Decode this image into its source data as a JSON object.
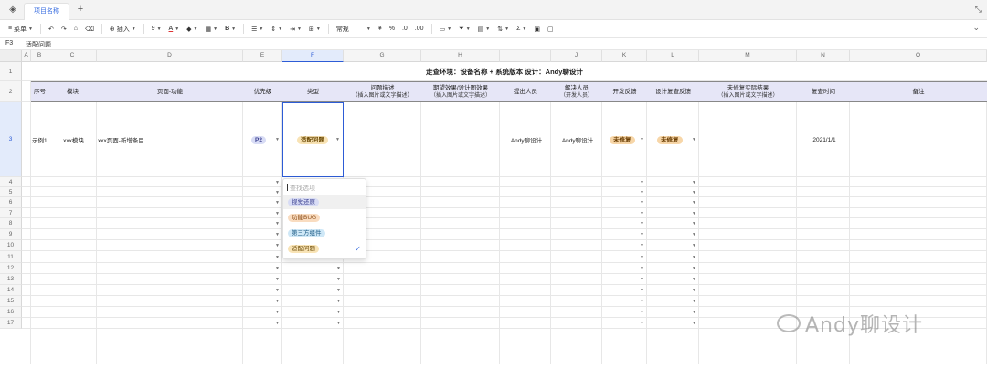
{
  "tabbar": {
    "tab_label": "项目名称",
    "add_label": "+",
    "resize_label": "⤡"
  },
  "toolbar": {
    "menu_label": "菜单",
    "insert_label": "插入",
    "font_size": "9",
    "format_label": "常规",
    "currency_symbol": "¥",
    "percent_symbol": "%",
    "sum_symbol": "Σ"
  },
  "formula": {
    "cell_ref": "F3",
    "value": "适配问题"
  },
  "columns": [
    "A",
    "B",
    "C",
    "D",
    "E",
    "F",
    "G",
    "H",
    "I",
    "J",
    "K",
    "L",
    "M",
    "N",
    "O"
  ],
  "rows": [
    "1",
    "2",
    "3",
    "4",
    "5",
    "6",
    "7",
    "8",
    "9",
    "10",
    "11",
    "12",
    "13",
    "14",
    "15",
    "16",
    "17"
  ],
  "sheet": {
    "title": "走查环境：设备名称 + 系统版本   设计：Andy聊设计",
    "headers": [
      {
        "col": "B",
        "main": "序号",
        "sub": ""
      },
      {
        "col": "C",
        "main": "模块",
        "sub": ""
      },
      {
        "col": "D",
        "main": "页面-功能",
        "sub": ""
      },
      {
        "col": "E",
        "main": "优先级",
        "sub": ""
      },
      {
        "col": "F",
        "main": "类型",
        "sub": ""
      },
      {
        "col": "G",
        "main": "问题描述",
        "sub": "（插入图片或文字描述）"
      },
      {
        "col": "H",
        "main": "期望效果/设计图效果",
        "sub": "（插入图片或文字描述）"
      },
      {
        "col": "I",
        "main": "提出人员",
        "sub": ""
      },
      {
        "col": "J",
        "main": "解决人员",
        "sub": "（开发人员）"
      },
      {
        "col": "K",
        "main": "开发反馈",
        "sub": ""
      },
      {
        "col": "L",
        "main": "设计复查反馈",
        "sub": ""
      },
      {
        "col": "M",
        "main": "未修复实际结果",
        "sub": "（插入图片或文字描述）"
      },
      {
        "col": "N",
        "main": "复查时间",
        "sub": ""
      },
      {
        "col": "O",
        "main": "备注",
        "sub": ""
      }
    ],
    "row3": {
      "index": "示例1",
      "module": "xxx模块",
      "page": "xxx页面-新增条目",
      "priority": "P2",
      "type": "适配问题",
      "proposer": "Andy聊设计",
      "resolver": "Andy聊设计",
      "dev_feedback": "未修复",
      "design_feedback": "未修复",
      "review_date": "2021/1/1"
    }
  },
  "dropdown": {
    "search_placeholder": "查找选项",
    "options": [
      {
        "label": "视觉还原",
        "color": "#d8dcf5",
        "text": "#3a3f8f"
      },
      {
        "label": "功能BUG",
        "color": "#f9dcc0",
        "text": "#8a4a12"
      },
      {
        "label": "第三方组件",
        "color": "#cfe8f7",
        "text": "#1f5c86"
      },
      {
        "label": "适配问题",
        "color": "#f8e3b5",
        "text": "#6b4a05"
      }
    ],
    "selected_index": 3
  },
  "colors": {
    "p2_bg": "#d8dcf5",
    "p2_text": "#3a3f8f",
    "type_bg": "#f8e3b5",
    "type_text": "#6b4a05",
    "status_bg": "#f7d6a8",
    "status_text": "#6b3f05",
    "header_band": "#e6e6f7",
    "accent": "#2d5cd6"
  },
  "watermark": {
    "text": "Andy聊设计"
  }
}
